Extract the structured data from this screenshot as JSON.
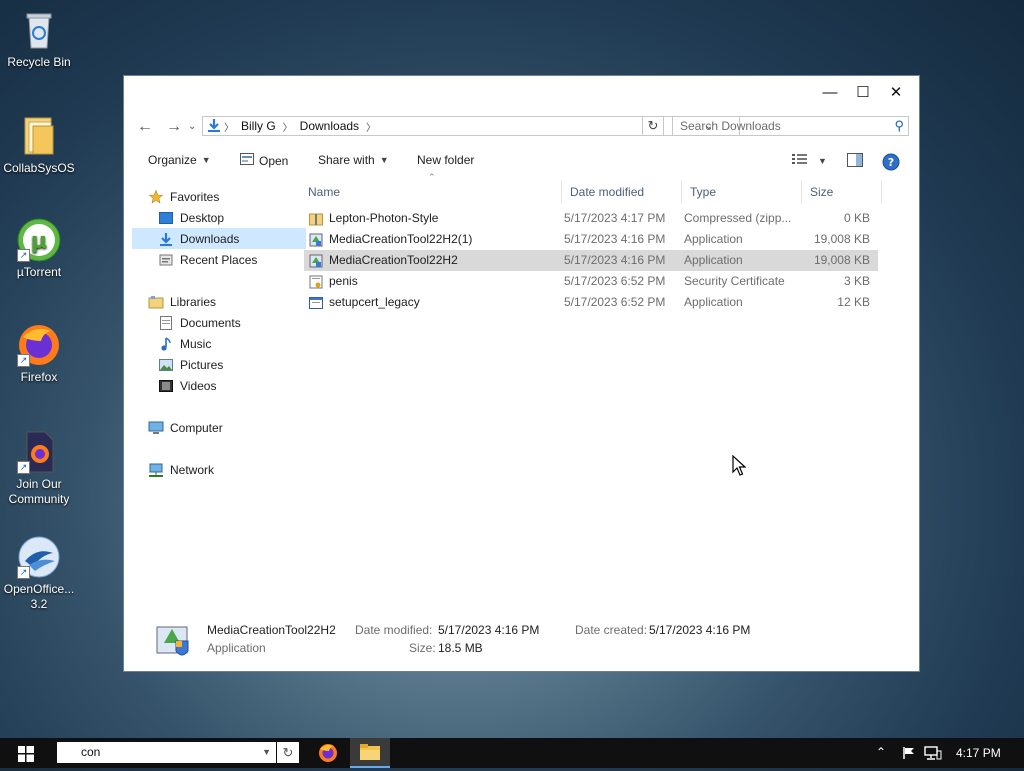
{
  "desktop": {
    "icons": [
      {
        "label": "Recycle Bin",
        "icon": "recycle-bin-icon"
      },
      {
        "label": "CollabSysOS",
        "icon": "folder-icon"
      },
      {
        "label": "µTorrent",
        "icon": "utorrent-icon"
      },
      {
        "label": "Firefox",
        "icon": "firefox-icon"
      },
      {
        "label": "Join Our Community",
        "icon": "firefox-file-icon"
      },
      {
        "label": "OpenOffice... 3.2",
        "icon": "openoffice-icon"
      }
    ]
  },
  "window": {
    "breadcrumb": [
      "Billy G",
      "Downloads"
    ],
    "search_placeholder": "Search Downloads",
    "toolbar": {
      "organize": "Organize",
      "open": "Open",
      "share_with": "Share with",
      "new_folder": "New folder"
    },
    "nav": {
      "favorites": "Favorites",
      "desktop": "Desktop",
      "downloads": "Downloads",
      "recent_places": "Recent Places",
      "libraries": "Libraries",
      "documents": "Documents",
      "music": "Music",
      "pictures": "Pictures",
      "videos": "Videos",
      "computer": "Computer",
      "network": "Network"
    },
    "columns": {
      "name": "Name",
      "date_modified": "Date modified",
      "type": "Type",
      "size": "Size"
    },
    "files": [
      {
        "name": "Lepton-Photon-Style",
        "date": "5/17/2023 4:17 PM",
        "type": "Compressed (zipp...",
        "size": "0 KB",
        "icon": "zip-folder-icon"
      },
      {
        "name": "MediaCreationTool22H2(1)",
        "date": "5/17/2023 4:16 PM",
        "type": "Application",
        "size": "19,008 KB",
        "icon": "setup-app-icon"
      },
      {
        "name": "MediaCreationTool22H2",
        "date": "5/17/2023 4:16 PM",
        "type": "Application",
        "size": "19,008 KB",
        "icon": "setup-app-icon"
      },
      {
        "name": "penis",
        "date": "5/17/2023 6:52 PM",
        "type": "Security Certificate",
        "size": "3 KB",
        "icon": "certificate-icon"
      },
      {
        "name": "setupcert_legacy",
        "date": "5/17/2023 6:52 PM",
        "type": "Application",
        "size": "12 KB",
        "icon": "application-icon"
      }
    ],
    "details": {
      "name": "MediaCreationTool22H2",
      "type": "Application",
      "date_modified_label": "Date modified:",
      "date_modified": "5/17/2023 4:16 PM",
      "size_label": "Size:",
      "size": "18.5 MB",
      "date_created_label": "Date created:",
      "date_created": "5/17/2023 4:16 PM"
    }
  },
  "taskbar": {
    "search_value": "con",
    "clock": "4:17 PM"
  }
}
